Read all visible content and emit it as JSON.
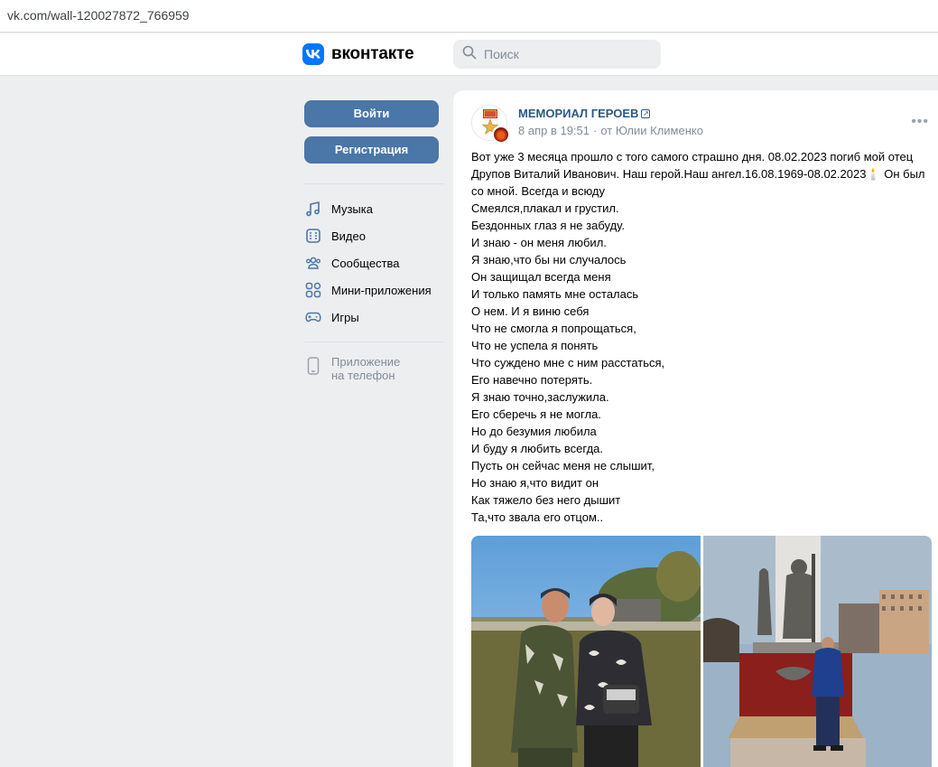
{
  "browser": {
    "url": "vk.com/wall-120027872_766959"
  },
  "header": {
    "logo_text": "вконтакте",
    "search_placeholder": "Поиск"
  },
  "sidebar": {
    "login_label": "Войти",
    "register_label": "Регистрация",
    "menu": [
      {
        "label": "Музыка",
        "icon": "music-icon"
      },
      {
        "label": "Видео",
        "icon": "video-icon"
      },
      {
        "label": "Сообщества",
        "icon": "communities-icon"
      },
      {
        "label": "Мини-приложения",
        "icon": "mini-apps-icon"
      },
      {
        "label": "Игры",
        "icon": "games-icon"
      }
    ],
    "app_line1": "Приложение",
    "app_line2": "на телефон"
  },
  "post": {
    "author": "МЕМОРИАЛ ГЕРОЕВ",
    "date": "8 апр в 19:51",
    "from": "от Юлии Клименко",
    "intro": "Вот уже 3 месяца прошло с того самого страшно дня. 08.02.2023 погиб мой отец Друпов Виталий Иванович. Наш герой.Наш ангел.16.08.1969-08.02.2023🕯️ Он был со мной. Всегда и всюду",
    "lines": [
      "Смеялся,плакал и грустил.",
      "Бездонных глаз я не забуду.",
      "И знаю - он меня любил.",
      "Я знаю,что бы ни случалось",
      "Он защищал всегда меня",
      "И только память мне осталась",
      "О нем. И я виню себя",
      "Что не смогла я попрощаться,",
      "Что не успела я понять",
      "Что суждено мне с ним расстаться,",
      "Его навечно потерять.",
      "Я знаю точно,заслужила.",
      "Его сберечь я не могла.",
      "Но до безумия любила",
      "И буду я любить всегда.",
      "Пусть он сейчас меня не слышит,",
      "Но знаю я,что видит он",
      "Как тяжело без него дышит",
      "Та,что звала его отцом.."
    ]
  },
  "colors": {
    "accent": "#4a76a8",
    "link": "#2a5885",
    "vk_blue": "#0077ff",
    "background": "#edeef0"
  }
}
